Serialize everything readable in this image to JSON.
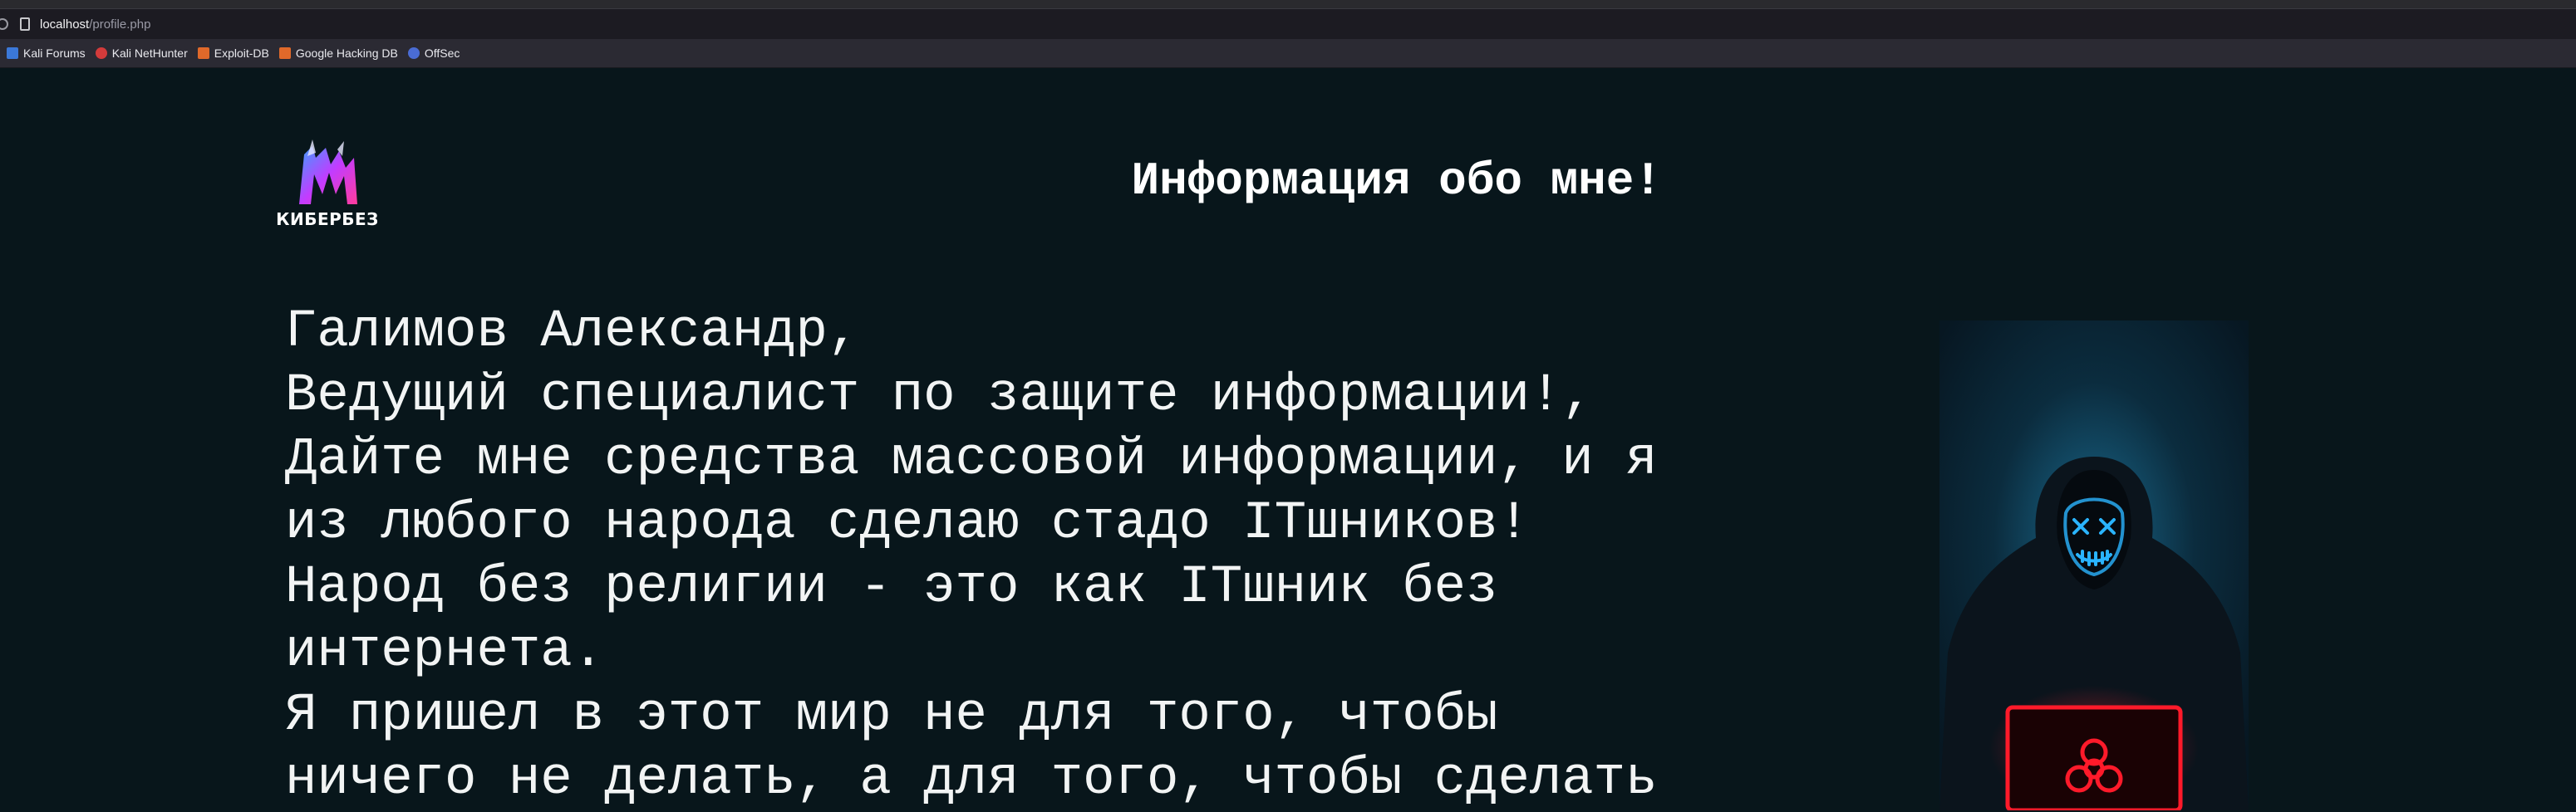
{
  "browser": {
    "url_host": "localhost",
    "url_path": "/profile.php",
    "bookmarks": [
      {
        "label": "Kali Forums",
        "icon": "kali-forums-icon",
        "color": "#3b78d8"
      },
      {
        "label": "Kali NetHunter",
        "icon": "kali-nethunter-icon",
        "color": "#d33b3b"
      },
      {
        "label": "Exploit-DB",
        "icon": "exploit-db-icon",
        "color": "#e0692a"
      },
      {
        "label": "Google Hacking DB",
        "icon": "google-hacking-db-icon",
        "color": "#e0692a"
      },
      {
        "label": "OffSec",
        "icon": "offsec-icon",
        "color": "#4a6cd4"
      }
    ]
  },
  "page": {
    "logo_text": "КИБЕРБЕЗ",
    "heading": "Информация обо мне!",
    "lines": [
      "Галимов Александр,",
      "Ведущий специалист по защите информации!,",
      "Дайте мне средства массовой информации, и я",
      "из любого народа сделаю стадо ITшников!",
      "Народ без религии - это как ITшник без",
      "интернета.",
      "Я пришел в этот мир не для того, чтобы",
      "ничего не делать, а для того, чтобы сделать"
    ]
  },
  "colors": {
    "background": "#08161b",
    "text": "#f2f4f4",
    "logo_gradient": [
      "#3aa0ff",
      "#c23cff",
      "#ff3c9c"
    ],
    "mask_glow": "#2ab4ff",
    "laptop_glow": "#ff1a2a"
  }
}
